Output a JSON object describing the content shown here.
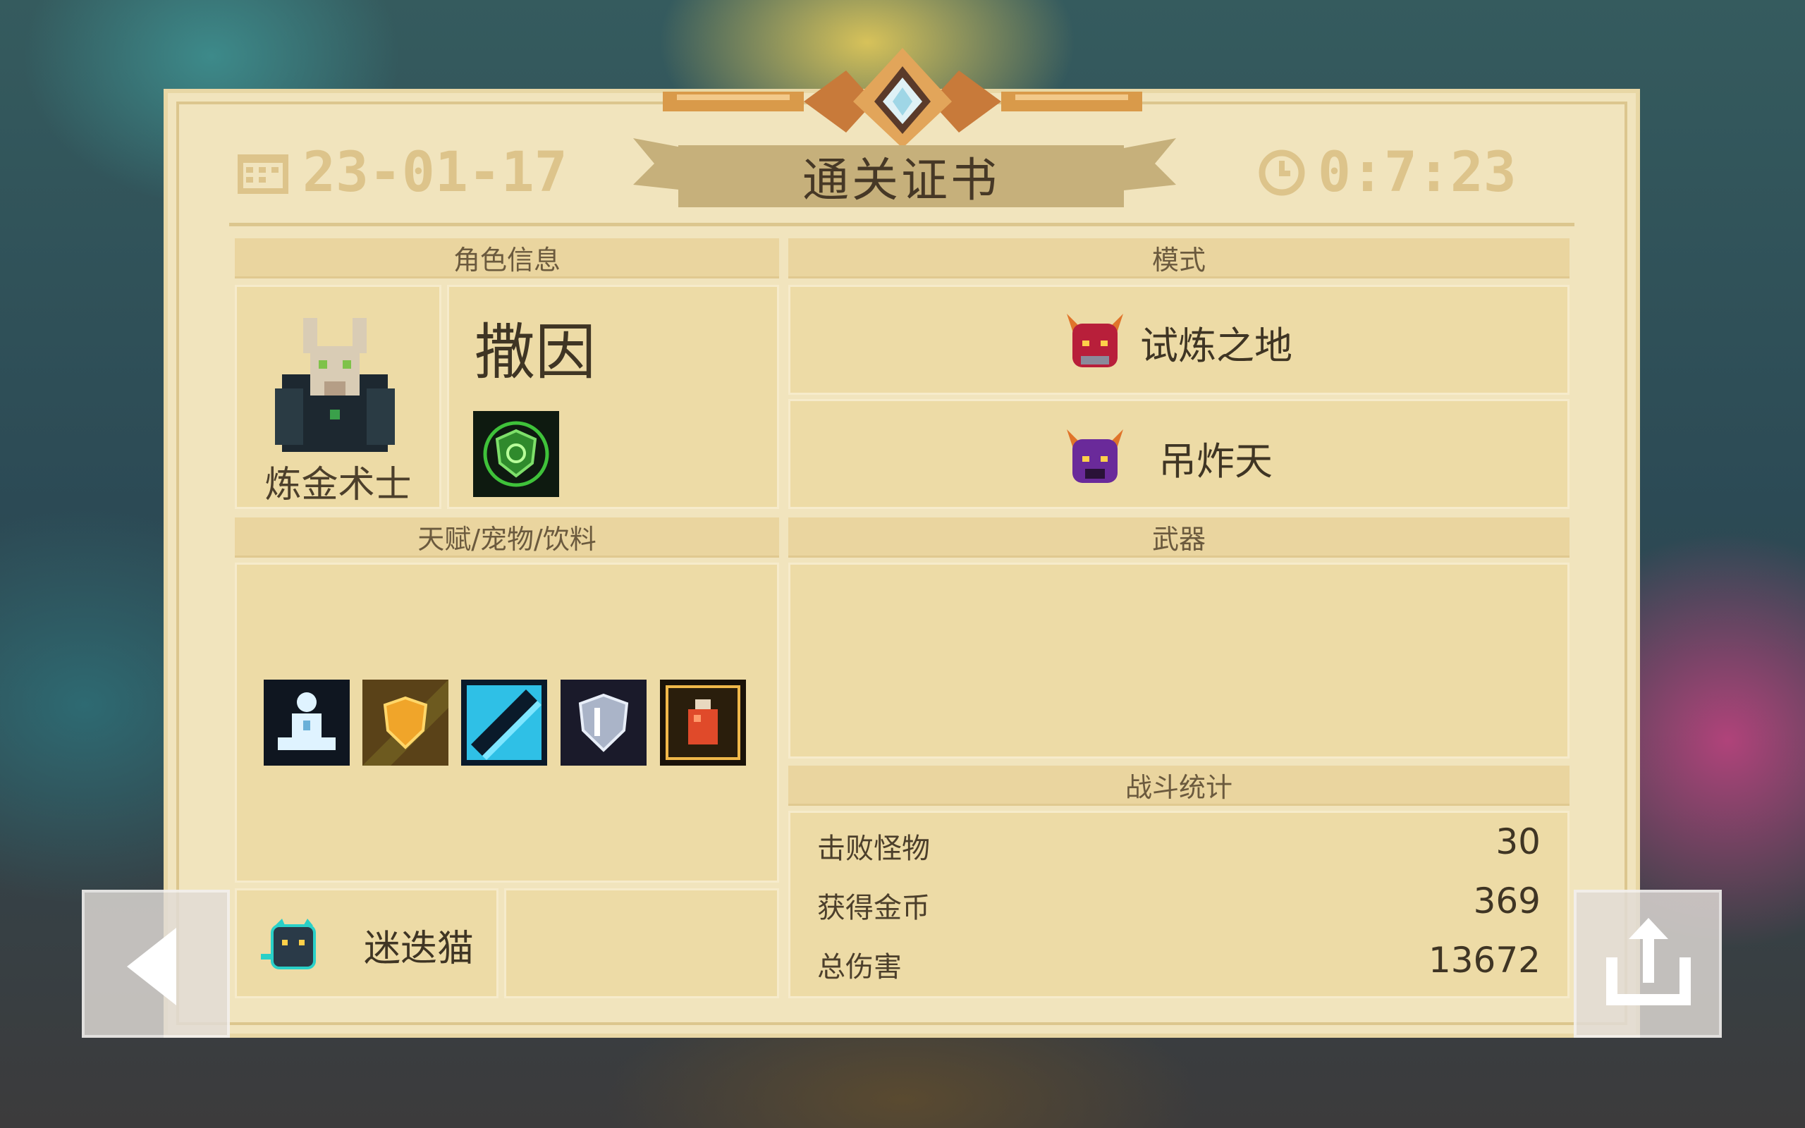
{
  "header": {
    "date": "23-01-17",
    "title": "通关证书",
    "time": "0:7:23"
  },
  "character": {
    "section_title": "角色信息",
    "name": "撒因",
    "class_name": "炼金术士"
  },
  "mode": {
    "section_title": "模式",
    "primary": "试炼之地",
    "secondary": "吊炸天"
  },
  "items": {
    "section_title": "天赋/宠物/饮料",
    "pet_name": "迷迭猫"
  },
  "weapons": {
    "section_title": "武器"
  },
  "stats": {
    "section_title": "战斗统计",
    "rows": [
      {
        "label": "击败怪物",
        "value": "30"
      },
      {
        "label": "获得金币",
        "value": "369"
      },
      {
        "label": "总伤害",
        "value": "13672"
      }
    ]
  },
  "colors": {
    "card_bg": "#f1e4bd",
    "header_bg": "#ead59f",
    "title_ribbon": "#c6b07b",
    "accent_gold": "#d9a24a"
  }
}
